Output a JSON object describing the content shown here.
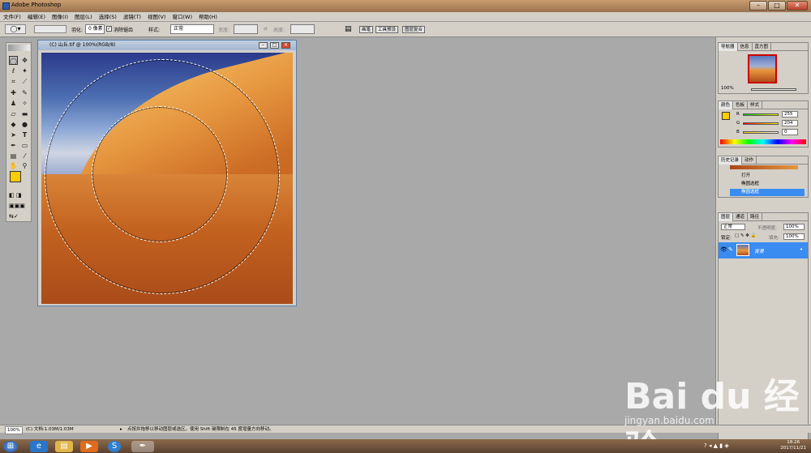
{
  "titlebar": {
    "title": "Adobe Photoshop",
    "min": "–",
    "max": "□",
    "close": "✕"
  },
  "menu": [
    "文件(F)",
    "编辑(E)",
    "图像(I)",
    "图层(L)",
    "选择(S)",
    "滤镜(T)",
    "视图(V)",
    "窗口(W)",
    "帮助(H)"
  ],
  "options": {
    "feather_label": "羽化:",
    "feather_value": "0 像素",
    "antialias": "消除锯齿",
    "style_label": "样式:",
    "style_value": "正常",
    "width_label": "宽度:",
    "height_label": "高度:",
    "pills": [
      "画笔",
      "工具预设",
      "图层复合"
    ]
  },
  "document": {
    "title": "(C) 山丘.tif @ 100%(RGB/8)"
  },
  "navigator": {
    "tabs": [
      "导航器",
      "信息",
      "直方图"
    ],
    "zoom": "100%"
  },
  "color": {
    "tabs": [
      "颜色",
      "色板",
      "样式"
    ],
    "channels": [
      {
        "label": "R",
        "value": "255"
      },
      {
        "label": "G",
        "value": "204"
      },
      {
        "label": "B",
        "value": "0"
      }
    ],
    "foreground": "#ffcc00"
  },
  "history": {
    "tabs": [
      "历史记录",
      "动作"
    ],
    "items": [
      "打开",
      "椭圆选框",
      "椭圆选框"
    ]
  },
  "layers": {
    "tabs": [
      "图层",
      "通道",
      "路径"
    ],
    "mode": "正常",
    "opacity_label": "不透明度:",
    "opacity": "100%",
    "lock_label": "锁定:",
    "fill_label": "填充:",
    "fill": "100%",
    "layer_name": "背景"
  },
  "status": {
    "zoom": "100%",
    "doc": "(C) 文档:1.03M/1.03M",
    "hint": "点按并拖移以移动图层或选区。使用 Shift 键限制在 45 度增量方向移动。"
  },
  "watermark": {
    "logo": "Bai du 经验",
    "url": "jingyan.baidu.com"
  },
  "clock": {
    "time": "18:26",
    "date": "2017/11/21"
  }
}
